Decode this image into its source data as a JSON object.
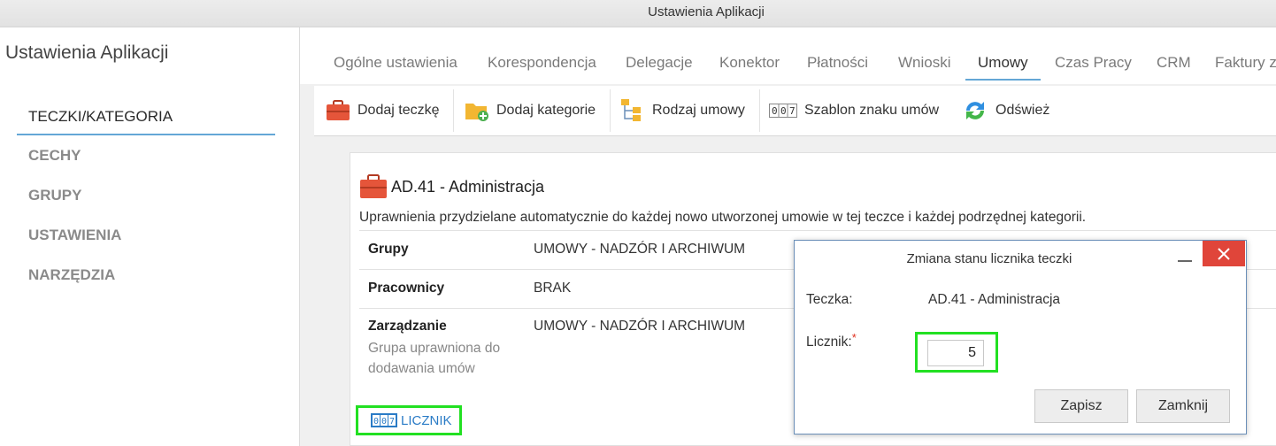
{
  "window": {
    "title": "Ustawienia Aplikacji"
  },
  "left_panel": {
    "title": "Ustawienia Aplikacji",
    "nav": [
      {
        "label": "TECZKI/KATEGORIA",
        "active": true
      },
      {
        "label": "CECHY"
      },
      {
        "label": "GRUPY"
      },
      {
        "label": "USTAWIENIA"
      },
      {
        "label": "NARZĘDZIA"
      }
    ]
  },
  "tabs": [
    {
      "label": "Ogólne ustawienia"
    },
    {
      "label": "Korespondencja"
    },
    {
      "label": "Delegacje"
    },
    {
      "label": "Konektor"
    },
    {
      "label": "Płatności"
    },
    {
      "label": "Wnioski"
    },
    {
      "label": "Umowy",
      "active": true
    },
    {
      "label": "Czas Pracy"
    },
    {
      "label": "CRM"
    },
    {
      "label": "Faktury z"
    }
  ],
  "toolbar": {
    "add_folder": "Dodaj teczkę",
    "add_category": "Dodaj kategorie",
    "contract_type": "Rodzaj umowy",
    "number_template": "Szablon znaku umów",
    "refresh": "Odśwież"
  },
  "folder": {
    "title": "AD.41 - Administracja",
    "description": "Uprawnienia przydzielane automatycznie do każdej nowo utworzonej umowie w tej teczce i każdej podrzędnej kategorii.",
    "rows": [
      {
        "label": "Grupy",
        "value": "UMOWY - NADZÓR I ARCHIWUM"
      },
      {
        "label": "Pracownicy",
        "value": "BRAK"
      },
      {
        "label": "Zarządzanie",
        "value": "UMOWY - NADZÓR I ARCHIWUM",
        "sub": "Grupa uprawniona do dodawania umów"
      }
    ],
    "counter_link": "LICZNIK"
  },
  "dialog": {
    "title": "Zmiana stanu licznika teczki",
    "folder_label": "Teczka:",
    "folder_value": "AD.41 - Administracja",
    "counter_label": "Licznik:",
    "required_mark": "*",
    "counter_value": "5",
    "save": "Zapisz",
    "close": "Zamknij"
  },
  "colors": {
    "accent": "#64a7d6",
    "highlight": "#22e022",
    "close_button": "#e0453a",
    "link": "#2a7bc6"
  }
}
